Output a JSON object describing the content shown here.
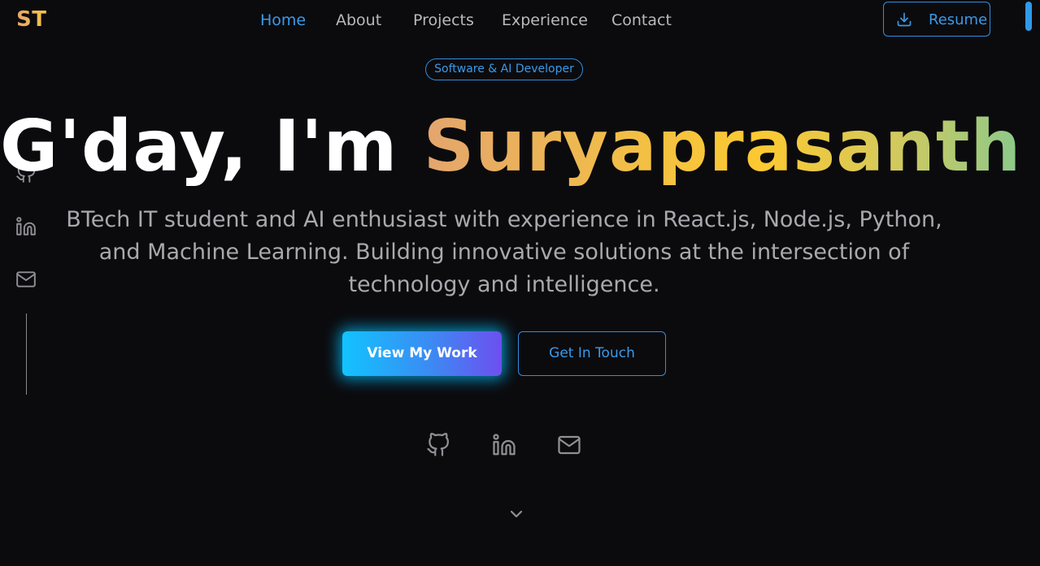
{
  "header": {
    "logo": "ST",
    "nav": [
      {
        "label": "Home",
        "active": true
      },
      {
        "label": "About",
        "active": false
      },
      {
        "label": "Projects",
        "active": false
      },
      {
        "label": "Experience",
        "active": false
      },
      {
        "label": "Contact",
        "active": false
      }
    ],
    "resume_label": "Resume",
    "resume_icon": "download-icon"
  },
  "hero": {
    "badge": "Software & AI Developer",
    "greeting": "G'day, I'm ",
    "name": "Suryaprasanth T",
    "tagline": "BTech IT student and AI enthusiast with experience in React.js, Node.js, Python, and Machine Learning. Building innovative solutions at the intersection of technology and intelligence.",
    "primary_button": "View My Work",
    "secondary_button": "Get In Touch"
  },
  "social": {
    "icons": [
      "github-icon",
      "linkedin-icon",
      "mail-icon"
    ]
  },
  "scroll_indicator_icon": "chevron-down-icon",
  "colors": {
    "background": "#0b0b0e",
    "accent": "#3b9ae8",
    "nav_text": "#b8b8be",
    "name_gradient": [
      "#e3a56e",
      "#f4c241",
      "#fcc931",
      "#86c98e",
      "#6cc79b"
    ],
    "primary_button_gradient": [
      "#12c3ff",
      "#6d4ff0"
    ]
  }
}
